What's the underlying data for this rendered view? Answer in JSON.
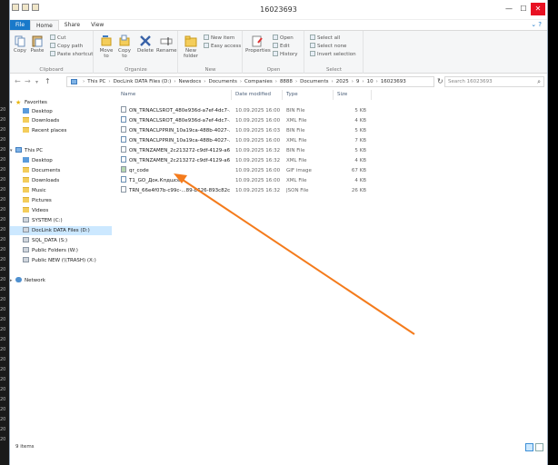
{
  "window": {
    "title": "16023693"
  },
  "left_strip_labels": [
    "20",
    "20",
    "20",
    "20",
    "20",
    "20",
    "20",
    "20",
    "20",
    "20",
    "20",
    "20",
    "20",
    "20",
    "20",
    "20",
    "20",
    "20",
    "20",
    "20",
    "20",
    "20",
    "20",
    "20",
    "20",
    "20",
    "20",
    "20",
    "20",
    "20",
    "20",
    "20",
    "20",
    "20"
  ],
  "ribbon_tabs": [
    "File",
    "Home",
    "Share",
    "View"
  ],
  "ribbon": {
    "clipboard": {
      "label": "Clipboard",
      "copy": "Copy",
      "paste": "Paste",
      "cut": "Cut",
      "copy_path": "Copy path",
      "paste_shortcut": "Paste shortcut"
    },
    "organize": {
      "label": "Organize",
      "move_to": "Move to",
      "copy_to": "Copy to",
      "delete": "Delete",
      "rename": "Rename"
    },
    "new": {
      "label": "New",
      "new_folder": "New folder",
      "new_item": "New item",
      "easy_access": "Easy access"
    },
    "open": {
      "label": "Open",
      "properties": "Properties",
      "open": "Open",
      "edit": "Edit",
      "history": "History"
    },
    "select": {
      "label": "Select",
      "select_all": "Select all",
      "select_none": "Select none",
      "invert": "Invert selection"
    }
  },
  "address": {
    "parts": [
      "This PC",
      "DocLink DATA Files (D:)",
      "Newdocs",
      "Documents",
      "Companies",
      "8888",
      "Documents",
      "2025",
      "9",
      "10",
      "16023693"
    ],
    "search_placeholder": "Search 16023693"
  },
  "nav": {
    "favorites": "Favorites",
    "fav_items": [
      "Desktop",
      "Downloads",
      "Recent places"
    ],
    "this_pc": "This PC",
    "pc_items": [
      "Desktop",
      "Documents",
      "Downloads",
      "Music",
      "Pictures",
      "Videos",
      "SYSTEM (C:)",
      "DocLink DATA Files (D:)",
      "SQL_DATA (S:)",
      "Public Folders (W:)",
      "Public NEW (\\\\TRASH) (X:)"
    ],
    "network": "Network"
  },
  "columns": {
    "name": "Name",
    "date": "Date modified",
    "type": "Type",
    "size": "Size"
  },
  "files": [
    {
      "name": "ON_TRNACLSROT_480e936d-a7ef-4dc7-...",
      "date": "10.09.2025 16:00",
      "type": "BIN File",
      "size": "5 KB",
      "kind": "bin"
    },
    {
      "name": "ON_TRNACLSROT_480e936d-a7ef-4dc7-...",
      "date": "10.09.2025 16:00",
      "type": "XML File",
      "size": "4 KB",
      "kind": "xml"
    },
    {
      "name": "ON_TRNACLPPRIN_10a19ca-488b-4027-...",
      "date": "10.09.2025 16:03",
      "type": "BIN File",
      "size": "5 KB",
      "kind": "bin"
    },
    {
      "name": "ON_TRNACLPPRIN_10a19ca-488b-4027-...",
      "date": "10.09.2025 16:00",
      "type": "XML File",
      "size": "7 KB",
      "kind": "xml"
    },
    {
      "name": "ON_TRNZAMEN_2c213272-c9df-4129-a6...",
      "date": "10.09.2025 16:32",
      "type": "BIN File",
      "size": "5 KB",
      "kind": "bin"
    },
    {
      "name": "ON_TRNZAMEN_2c213272-c9df-4129-a6...",
      "date": "10.09.2025 16:32",
      "type": "XML File",
      "size": "4 KB",
      "kind": "xml"
    },
    {
      "name": "qr_code",
      "date": "10.09.2025 16:00",
      "type": "GIF image",
      "size": "67 KB",
      "kind": "gif"
    },
    {
      "name": "T1_GO_Док.Кпдшсе",
      "date": "10.09.2025 16:00",
      "type": "XML File",
      "size": "4 KB",
      "kind": "xml"
    },
    {
      "name": "TRN_66e4f07b-c99c-...89-b626-893c82c9...",
      "date": "10.09.2025 16:32",
      "type": "JSON File",
      "size": "26 KB",
      "kind": "bin"
    }
  ],
  "status": {
    "items": "9 items"
  },
  "colors": {
    "accent": "#1979ca",
    "selection": "#cce8ff",
    "annotation_arrow": "#f47b1c"
  }
}
